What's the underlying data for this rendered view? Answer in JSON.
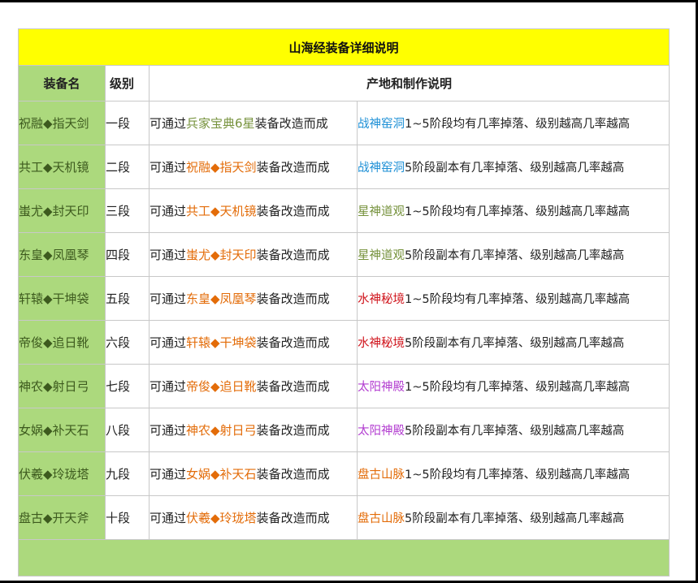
{
  "title": "山海经装备详细说明",
  "headers": {
    "name": "装备名",
    "level": "级别",
    "description": "产地和制作说明"
  },
  "method_prefix": "可通过",
  "method_suffix": "装备改造而成",
  "colors": {
    "title_bg": "#ffff00",
    "name_bg": "#acd97d",
    "material_text": "#e36c09",
    "first_material_text": "#76923c",
    "zhanshen": "#1e90d6",
    "xingshen": "#76923c",
    "shuishen": "#d0141c",
    "taiyang": "#b23cd0",
    "pangu": "#e36c09"
  },
  "rows": [
    {
      "name": "祝融◆指天剑",
      "level": "一段",
      "material": "兵家宝典6星",
      "material_color": "#76923c",
      "location": "战神窑洞",
      "location_color": "#1e90d6",
      "detail": "1~5阶段均有几率掉落、级别越高几率越高"
    },
    {
      "name": "共工◆天机镜",
      "level": "二段",
      "material": "祝融◆指天剑",
      "material_color": "#e36c09",
      "location": "战神窑洞",
      "location_color": "#1e90d6",
      "detail": "5阶段副本有几率掉落、级别越高几率越高"
    },
    {
      "name": "蚩尤◆封天印",
      "level": "三段",
      "material": "共工◆天机镜",
      "material_color": "#e36c09",
      "location": "星神道观",
      "location_color": "#76923c",
      "detail": "1~5阶段均有几率掉落、级别越高几率越高"
    },
    {
      "name": "东皇◆凤凰琴",
      "level": "四段",
      "material": "蚩尤◆封天印",
      "material_color": "#e36c09",
      "location": "星神道观",
      "location_color": "#76923c",
      "detail": "5阶段副本有几率掉落、级别越高几率越高"
    },
    {
      "name": "轩辕◆干坤袋",
      "level": "五段",
      "material": "东皇◆凤凰琴",
      "material_color": "#e36c09",
      "location": "水神秘境",
      "location_color": "#d0141c",
      "detail": "1~5阶段均有几率掉落、级别越高几率越高"
    },
    {
      "name": "帝俊◆追日靴",
      "level": "六段",
      "material": "轩辕◆干坤袋",
      "material_color": "#e36c09",
      "location": "水神秘境",
      "location_color": "#d0141c",
      "detail": "5阶段副本有几率掉落、级别越高几率越高"
    },
    {
      "name": "神农◆射日弓",
      "level": "七段",
      "material": "帝俊◆追日靴",
      "material_color": "#e36c09",
      "location": "太阳神殿",
      "location_color": "#b23cd0",
      "detail": "1~5阶段均有几率掉落、级别越高几率越高"
    },
    {
      "name": "女娲◆补天石",
      "level": "八段",
      "material": "神农◆射日弓",
      "material_color": "#e36c09",
      "location": "太阳神殿",
      "location_color": "#b23cd0",
      "detail": "5阶段副本有几率掉落、级别越高几率越高"
    },
    {
      "name": "伏羲◆玲珑塔",
      "level": "九段",
      "material": "女娲◆补天石",
      "material_color": "#e36c09",
      "location": "盘古山脉",
      "location_color": "#e36c09",
      "detail": "1~5阶段均有几率掉落、级别越高几率越高"
    },
    {
      "name": "盘古◆开天斧",
      "level": "十段",
      "material": "伏羲◆玲珑塔",
      "material_color": "#e36c09",
      "location": "盘古山脉",
      "location_color": "#e36c09",
      "detail": "5阶段副本有几率掉落、级别越高几率越高"
    }
  ]
}
